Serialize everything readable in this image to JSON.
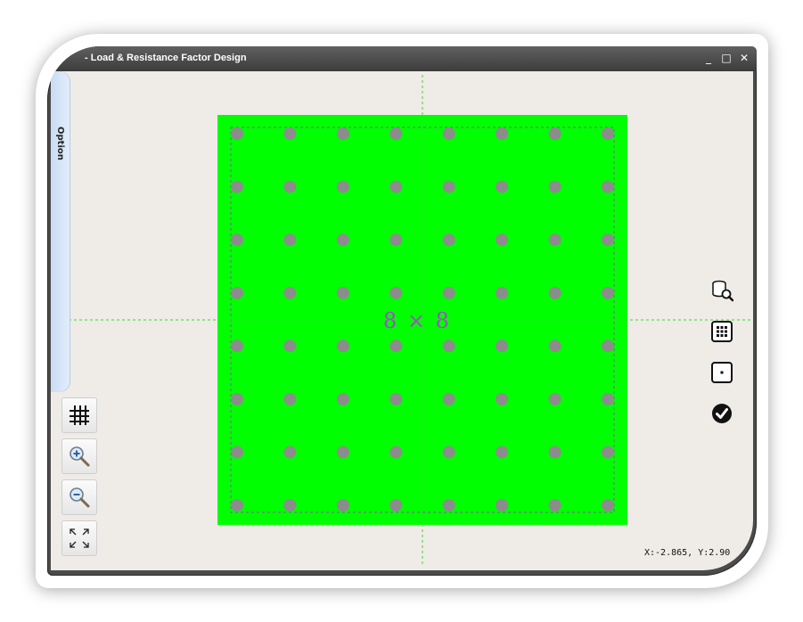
{
  "window": {
    "title": "- Load & Resistance Factor Design",
    "minimize": "_",
    "maximize": "□",
    "close": "✕"
  },
  "option_tab": {
    "label": "Option"
  },
  "section": {
    "label": "8 × 8",
    "rows": 8,
    "cols": 8,
    "fill_color": "#00ff00",
    "bar_color": "#8c8c8c",
    "guide_color": "#33dd33",
    "label_color": "#a24ec6"
  },
  "left_tools": [
    {
      "name": "grid-toggle-button",
      "icon": "grid-icon"
    },
    {
      "name": "zoom-in-button",
      "icon": "zoom-in-icon"
    },
    {
      "name": "zoom-out-button",
      "icon": "zoom-out-icon"
    },
    {
      "name": "fit-view-button",
      "icon": "expand-icon"
    }
  ],
  "right_tools": [
    {
      "name": "database-search-button",
      "icon": "database-search-icon"
    },
    {
      "name": "grid-layout-button",
      "icon": "grid-layout-icon"
    },
    {
      "name": "single-point-button",
      "icon": "single-point-icon"
    },
    {
      "name": "confirm-button",
      "icon": "check-circle-icon"
    }
  ],
  "status": {
    "coords": "X:-2.865, Y:2.90"
  }
}
